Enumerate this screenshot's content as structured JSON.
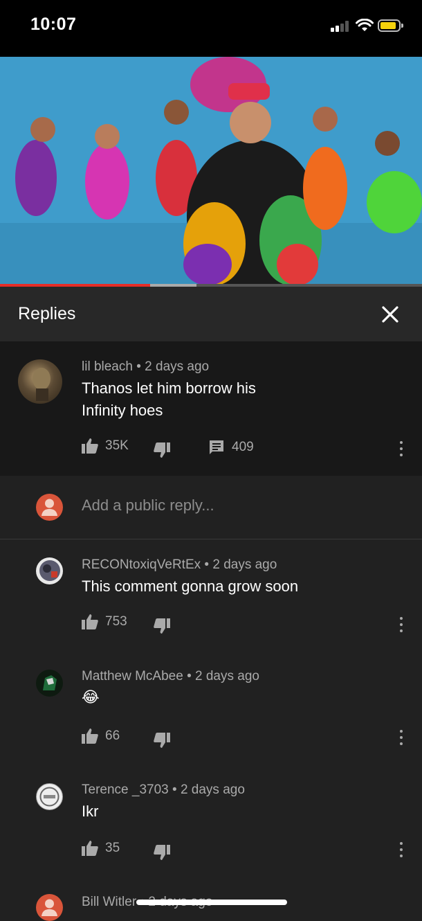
{
  "status": {
    "time": "10:07"
  },
  "replies_header": {
    "title": "Replies"
  },
  "main_comment": {
    "author": "lil bleach",
    "age": "2 days ago",
    "text_line1": "Thanos let him borrow his",
    "text_line2": "Infinity hoes",
    "likes": "35K",
    "reply_count": "409"
  },
  "add_reply": {
    "placeholder": "Add a public reply..."
  },
  "replies": [
    {
      "author": "RECONtoxiqVeRtEx",
      "age": "2 days ago",
      "text": "This comment gonna grow soon",
      "likes": "753"
    },
    {
      "author": "Matthew McAbee",
      "age": "2 days ago",
      "text": "😂",
      "likes": "66"
    },
    {
      "author": "Terence _3703",
      "age": "2 days ago",
      "text": "Ikr",
      "likes": "35"
    },
    {
      "author": "Bill Witler",
      "age": "2 days ago"
    }
  ],
  "video_progress": {
    "played_fraction": 0.355,
    "buffered_fraction": 0.465
  },
  "colors": {
    "accent": "#e52d27",
    "background": "#212121",
    "header": "#282828",
    "highlight": "#181818"
  }
}
